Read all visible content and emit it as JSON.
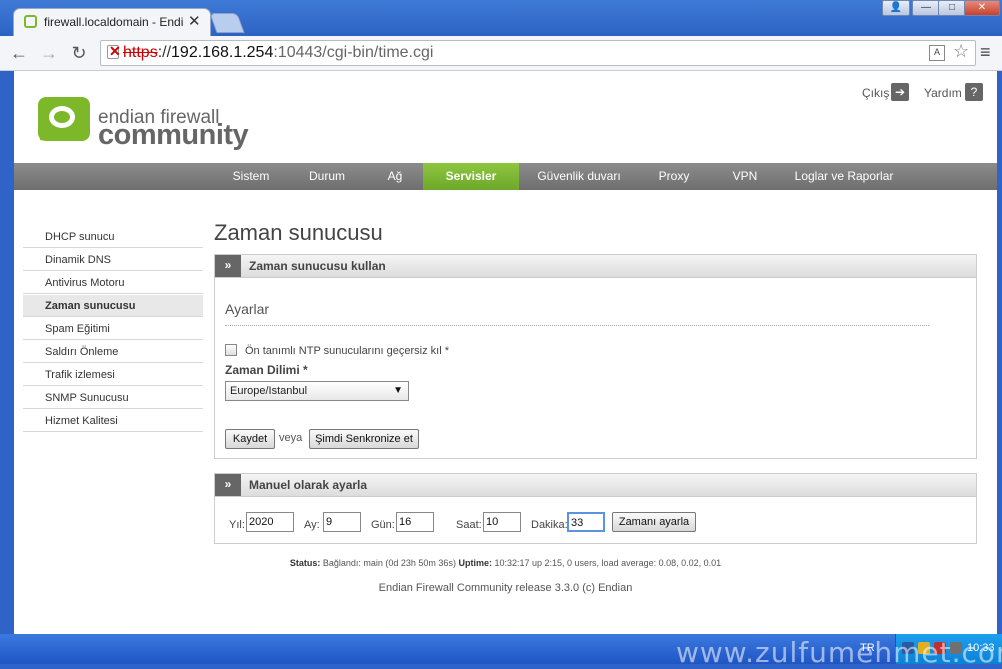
{
  "browser": {
    "tab_title": "firewall.localdomain - Endian",
    "tab_close": "✕",
    "url_scheme": "https",
    "url_sep": "://",
    "url_host": "192.168.1.254",
    "url_rest": ":10443/cgi-bin/time.cgi",
    "translate_glyph": "A",
    "star_glyph": "☆",
    "menu_glyph": "≡",
    "back_glyph": "←",
    "forward_glyph": "→",
    "reload_glyph": "↻",
    "win_user": "👤",
    "win_min": "—",
    "win_max": "□",
    "win_close": "✕"
  },
  "header": {
    "logo_line1": "endian firewall",
    "logo_line2": "community",
    "logo_dots": "●●●●●",
    "logout_label": "Çıkış",
    "help_label": "Yardım",
    "logout_icon": "➔",
    "help_icon": "?"
  },
  "mainnav": {
    "items": [
      "Sistem",
      "Durum",
      "Ağ",
      "Servisler",
      "Güvenlik duvarı",
      "Proxy",
      "VPN",
      "Loglar ve Raporlar"
    ],
    "active": "Servisler"
  },
  "sidebar": {
    "items": [
      "DHCP sunucu",
      "Dinamik DNS",
      "Antivirus Motoru",
      "Zaman sunucusu",
      "Spam Eğitimi",
      "Saldırı Önleme",
      "Trafik izlemesi",
      "SNMP Sunucusu",
      "Hizmet Kalitesi"
    ],
    "active": "Zaman sunucusu"
  },
  "page_title": "Zaman sunucusu",
  "panel1": {
    "chevron": "»",
    "title": "Zaman sunucusu kullan",
    "section_title": "Ayarlar",
    "checkbox_label": "Ön tanımlı NTP sunucularını geçersiz kıl *",
    "checkbox_checked": false,
    "timezone_label": "Zaman Dilimi *",
    "timezone_value": "Europe/Istanbul",
    "select_arrow": "▼",
    "save_button": "Kaydet",
    "or_text": "veya",
    "sync_button": "Şimdi Senkronize et"
  },
  "panel2": {
    "chevron": "»",
    "title": "Manuel olarak ayarla",
    "year_label": "Yıl:",
    "year_value": "2020",
    "month_label": "Ay:",
    "month_value": "9",
    "day_label": "Gün:",
    "day_value": "16",
    "hour_label": "Saat:",
    "hour_value": "10",
    "minute_label": "Dakika:",
    "minute_value": "33",
    "set_button": "Zamanı ayarla"
  },
  "status": {
    "status_label": "Status:",
    "status_text": "Bağlandı: main (0d 23h 50m 36s)",
    "uptime_label": "Uptime:",
    "uptime_text": "10:32:17 up 2:15, 0 users, load average: 0.08, 0.02, 0.01"
  },
  "footer": "Endian Firewall Community release 3.3.0 (c) Endian",
  "taskbar": {
    "lang": "TR",
    "clock": "10:33",
    "watermark": "www.zulfumehmet.com"
  },
  "colors": {
    "accent_green": "#7cb829",
    "nav_gray": "#7a7a7a",
    "taskbar_blue": "#2f63c8"
  }
}
